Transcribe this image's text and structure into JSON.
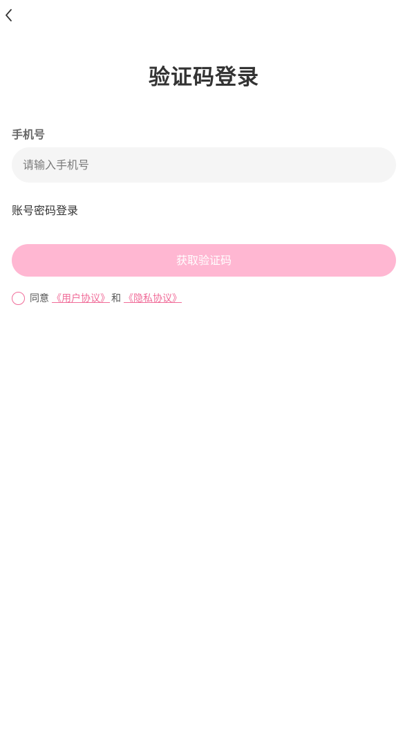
{
  "header": {
    "title": "验证码登录"
  },
  "form": {
    "phone_label": "手机号",
    "phone_value": "",
    "phone_placeholder": "请输入手机号",
    "switch_label": "账号密码登录",
    "get_code_label": "获取验证码"
  },
  "agreement": {
    "checked": false,
    "prefix": "同意",
    "user_agreement": "《用户协议》",
    "conjunction": "和",
    "privacy_agreement": "《隐私协议》"
  },
  "colors": {
    "accent": "#f06b98",
    "button_disabled": "#ffb7d2",
    "input_background": "#f5f5f5"
  }
}
